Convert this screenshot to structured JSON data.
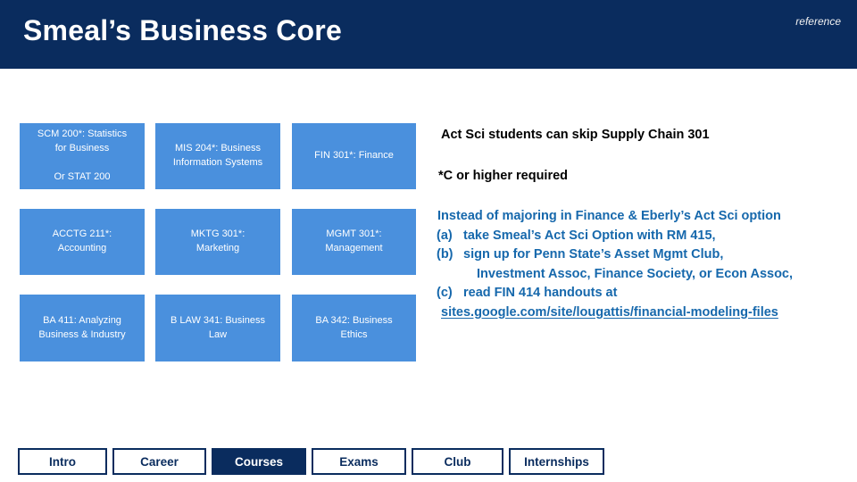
{
  "header": {
    "title": "Smeal’s Business Core",
    "reference_label": "reference",
    "band_color": "#0a2c5e"
  },
  "course_grid": {
    "box_color": "#4a90dd",
    "boxes": [
      {
        "row": 0,
        "col": 0,
        "label": "SCM 200*: Statistics\nfor Business\n\nOr STAT 200"
      },
      {
        "row": 0,
        "col": 1,
        "label": "MIS 204*: Business\nInformation Systems"
      },
      {
        "row": 0,
        "col": 2,
        "label": "FIN 301*: Finance"
      },
      {
        "row": 1,
        "col": 0,
        "label": "ACCTG 211*:\nAccounting"
      },
      {
        "row": 1,
        "col": 1,
        "label": "MKTG 301*:\nMarketing"
      },
      {
        "row": 1,
        "col": 2,
        "label": "MGMT 301*:\nManagement"
      },
      {
        "row": 2,
        "col": 0,
        "label": "BA 411: Analyzing\nBusiness & Industry"
      },
      {
        "row": 2,
        "col": 1,
        "label": "B LAW 341: Business\nLaw"
      },
      {
        "row": 2,
        "col": 2,
        "label": "BA 342: Business\nEthics"
      }
    ]
  },
  "notes": {
    "skip_note": "Act Sci students can skip Supply Chain 301",
    "grade_note": "*C or higher required"
  },
  "advice": {
    "color": "#1668ac",
    "intro": "Instead of majoring in Finance & Eberly’s Act Sci option",
    "items": [
      {
        "marker": "(a)",
        "text": "take Smeal’s Act Sci Option with RM 415,"
      },
      {
        "marker": "(b)",
        "text": "sign up for Penn State’s Asset Mgmt Club,"
      }
    ],
    "continuation": "Investment Assoc, Finance Society, or Econ Assoc,",
    "last_item": {
      "marker": "(c)",
      "text": "read FIN 414 handouts at"
    },
    "link": "sites.google.com/site/lougattis/financial-modeling-files"
  },
  "bottom_nav": {
    "active": "Courses",
    "buttons": [
      {
        "label": "Intro",
        "active": false
      },
      {
        "label": "Career",
        "active": false
      },
      {
        "label": "Courses",
        "active": true
      },
      {
        "label": "Exams",
        "active": false
      },
      {
        "label": "Club",
        "active": false
      },
      {
        "label": "Internships",
        "active": false
      }
    ]
  }
}
